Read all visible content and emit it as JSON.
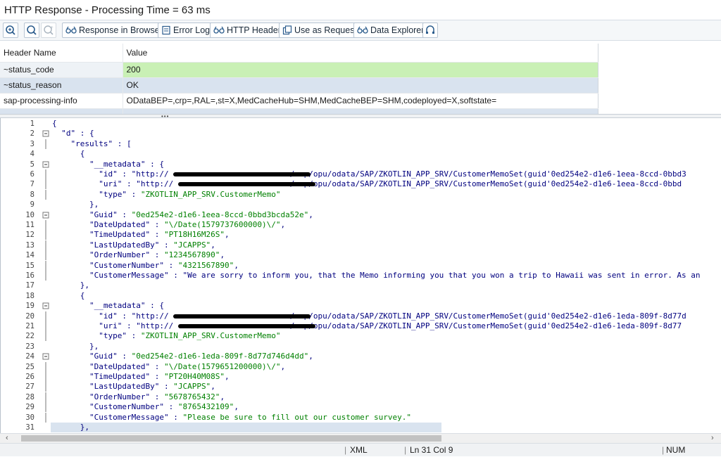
{
  "window": {
    "title": "HTTP Response - Processing Time = 63  ms"
  },
  "toolbar": {
    "response_in_browser": "Response in Browser",
    "error_log": "Error Log",
    "http_header": "HTTP Header",
    "use_as_request": "Use as Request",
    "data_explorer": "Data Explorer"
  },
  "header_table": {
    "col_name": "Header Name",
    "col_value": "Value",
    "rows": [
      {
        "name": "~status_code",
        "value": "200"
      },
      {
        "name": "~status_reason",
        "value": "OK"
      },
      {
        "name": "sap-processing-info",
        "value": "ODataBEP=,crp=,RAL=,st=X,MedCacheHub=SHM,MedCacheBEP=SHM,codeployed=X,softstate="
      },
      {
        "name": "",
        "value": ""
      }
    ]
  },
  "code_lines": [
    {
      "n": "1",
      "t": "{"
    },
    {
      "n": "2",
      "t": "  \"d\" : {"
    },
    {
      "n": "3",
      "t": "    \"results\" : ["
    },
    {
      "n": "4",
      "t": "      {"
    },
    {
      "n": "5",
      "t": "        \"__metadata\" : {"
    },
    {
      "n": "6",
      "t": "          \"id\" : \"http://                          /sap/opu/odata/SAP/ZKOTLIN_APP_SRV/CustomerMemoSet(guid'0ed254e2-d1e6-1eea-8ccd-0bbd3"
    },
    {
      "n": "7",
      "t": "          \"uri\" : \"http://                         /sap/opu/odata/SAP/ZKOTLIN_APP_SRV/CustomerMemoSet(guid'0ed254e2-d1e6-1eea-8ccd-0bbd"
    },
    {
      "n": "8",
      "t": "          \"type\" : \"ZKOTLIN_APP_SRV.CustomerMemo\""
    },
    {
      "n": "9",
      "t": "        },"
    },
    {
      "n": "10",
      "t": "        \"Guid\" : \"0ed254e2-d1e6-1eea-8ccd-0bbd3bcda52e\","
    },
    {
      "n": "11",
      "t": "        \"DateUpdated\" : \"\\/Date(1579737600000)\\/\","
    },
    {
      "n": "12",
      "t": "        \"TimeUpdated\" : \"PT18H16M26S\","
    },
    {
      "n": "13",
      "t": "        \"LastUpdatedBy\" : \"JCAPPS\","
    },
    {
      "n": "14",
      "t": "        \"OrderNumber\" : \"1234567890\","
    },
    {
      "n": "15",
      "t": "        \"CustomerNumber\" : \"4321567890\","
    },
    {
      "n": "16",
      "t": "        \"CustomerMessage\" : \"We are sorry to inform you, that the Memo informing you that you won a trip to Hawaii was sent in error. As an"
    },
    {
      "n": "17",
      "t": "      },"
    },
    {
      "n": "18",
      "t": "      {"
    },
    {
      "n": "19",
      "t": "        \"__metadata\" : {"
    },
    {
      "n": "20",
      "t": "          \"id\" : \"http://                          /sap/opu/odata/SAP/ZKOTLIN_APP_SRV/CustomerMemoSet(guid'0ed254e2-d1e6-1eda-809f-8d77d"
    },
    {
      "n": "21",
      "t": "          \"uri\" : \"http://                         /sap/opu/odata/SAP/ZKOTLIN_APP_SRV/CustomerMemoSet(guid'0ed254e2-d1e6-1eda-809f-8d77"
    },
    {
      "n": "22",
      "t": "          \"type\" : \"ZKOTLIN_APP_SRV.CustomerMemo\""
    },
    {
      "n": "23",
      "t": "        },"
    },
    {
      "n": "24",
      "t": "        \"Guid\" : \"0ed254e2-d1e6-1eda-809f-8d77d746d4dd\","
    },
    {
      "n": "25",
      "t": "        \"DateUpdated\" : \"\\/Date(1579651200000)\\/\","
    },
    {
      "n": "26",
      "t": "        \"TimeUpdated\" : \"PT20H40M08S\","
    },
    {
      "n": "27",
      "t": "        \"LastUpdatedBy\" : \"JCAPPS\","
    },
    {
      "n": "28",
      "t": "        \"OrderNumber\" : \"5678765432\","
    },
    {
      "n": "29",
      "t": "        \"CustomerNumber\" : \"8765432109\","
    },
    {
      "n": "30",
      "t": "        \"CustomerMessage\" : \"Please be sure to fill out our customer survey.\""
    },
    {
      "n": "31",
      "t": "      },"
    }
  ],
  "status_bar": {
    "format": "XML",
    "position": "Ln  31 Col   9",
    "num": "NUM"
  }
}
